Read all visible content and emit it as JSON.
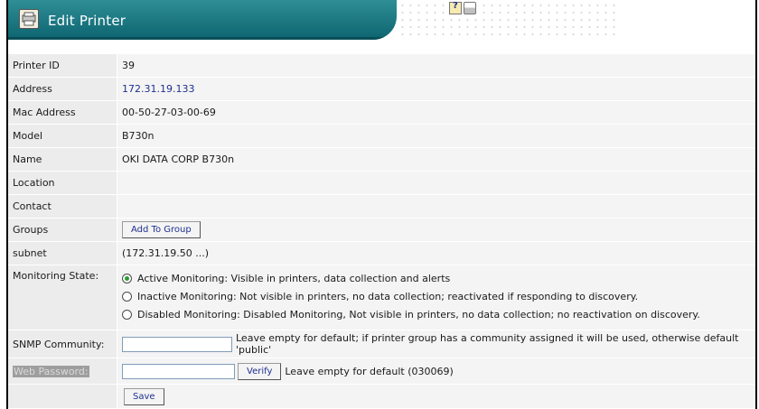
{
  "header": {
    "title": "Edit Printer",
    "icons": [
      "notepad-icon",
      "printer-icon"
    ],
    "accent_color": "#0e6a75"
  },
  "fields": {
    "printer_id": {
      "label": "Printer ID",
      "value": "39"
    },
    "address": {
      "label": "Address",
      "value": "172.31.19.133"
    },
    "mac_address": {
      "label": "Mac Address",
      "value": "00-50-27-03-00-69"
    },
    "model": {
      "label": "Model",
      "value": "B730n"
    },
    "name": {
      "label": "Name",
      "value": "OKI DATA CORP B730n"
    },
    "location": {
      "label": "Location",
      "value": ""
    },
    "contact": {
      "label": "Contact",
      "value": ""
    },
    "groups": {
      "label": "Groups",
      "button": "Add To Group"
    },
    "subnet": {
      "label": "subnet",
      "value": "(172.31.19.50 ...)"
    },
    "monitoring_state": {
      "label": "Monitoring State:",
      "options": [
        {
          "label": "Active Monitoring: Visible in printers, data collection and alerts",
          "checked": true
        },
        {
          "label": "Inactive Monitoring: Not visible in printers, no data collection; reactivated if responding to discovery.",
          "checked": false
        },
        {
          "label": "Disabled Monitoring: Disabled Monitoring, Not visible in printers, no data collection; no reactivation on discovery.",
          "checked": false
        }
      ]
    },
    "snmp_community": {
      "label": "SNMP Community:",
      "value": "",
      "hint": "Leave empty for default; if printer group has a community assigned it will be used, otherwise default 'public'"
    },
    "web_password": {
      "label": "Web Password:",
      "value": "",
      "verify_button": "Verify",
      "hint": "Leave empty for default (030069)"
    }
  },
  "actions": {
    "save": "Save"
  }
}
